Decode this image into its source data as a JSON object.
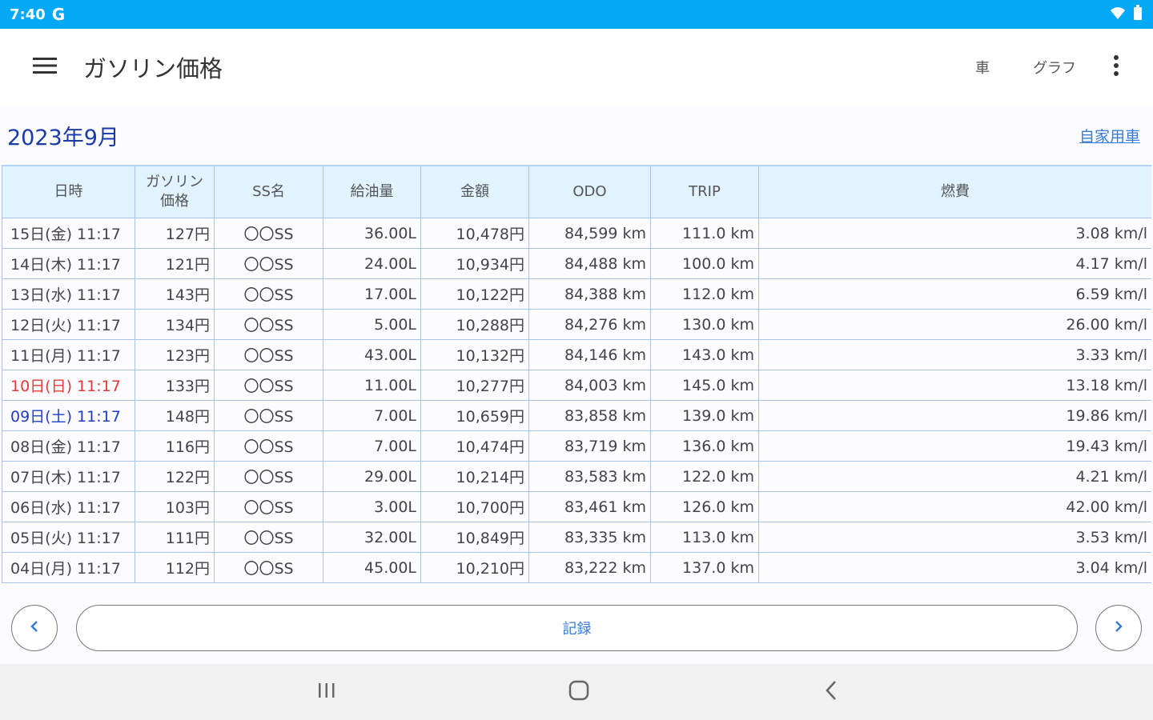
{
  "status_bar": {
    "time": "7:40",
    "carrier": "G"
  },
  "app_bar": {
    "title": "ガソリン価格",
    "actions": {
      "car": "車",
      "graph": "グラフ"
    }
  },
  "header": {
    "month": "2023年9月",
    "car_link": "自家用車"
  },
  "table": {
    "columns": [
      "日時",
      "ガソリン\n価格",
      "SS名",
      "給油量",
      "金額",
      "ODO",
      "TRIP",
      "燃費"
    ],
    "rows": [
      {
        "date": "15日(金) 11:17",
        "price": "127円",
        "ss": "〇〇SS",
        "volume": "36.00L",
        "amount": "10,478円",
        "odo": "84,599 km",
        "trip": "111.0 km",
        "mileage": "3.08 km/l",
        "day": "weekday"
      },
      {
        "date": "14日(木) 11:17",
        "price": "121円",
        "ss": "〇〇SS",
        "volume": "24.00L",
        "amount": "10,934円",
        "odo": "84,488 km",
        "trip": "100.0 km",
        "mileage": "4.17 km/l",
        "day": "weekday"
      },
      {
        "date": "13日(水) 11:17",
        "price": "143円",
        "ss": "〇〇SS",
        "volume": "17.00L",
        "amount": "10,122円",
        "odo": "84,388 km",
        "trip": "112.0 km",
        "mileage": "6.59 km/l",
        "day": "weekday"
      },
      {
        "date": "12日(火) 11:17",
        "price": "134円",
        "ss": "〇〇SS",
        "volume": "5.00L",
        "amount": "10,288円",
        "odo": "84,276 km",
        "trip": "130.0 km",
        "mileage": "26.00 km/l",
        "day": "weekday"
      },
      {
        "date": "11日(月) 11:17",
        "price": "123円",
        "ss": "〇〇SS",
        "volume": "43.00L",
        "amount": "10,132円",
        "odo": "84,146 km",
        "trip": "143.0 km",
        "mileage": "3.33 km/l",
        "day": "weekday"
      },
      {
        "date": "10日(日) 11:17",
        "price": "133円",
        "ss": "〇〇SS",
        "volume": "11.00L",
        "amount": "10,277円",
        "odo": "84,003 km",
        "trip": "145.0 km",
        "mileage": "13.18 km/l",
        "day": "sun"
      },
      {
        "date": "09日(土) 11:17",
        "price": "148円",
        "ss": "〇〇SS",
        "volume": "7.00L",
        "amount": "10,659円",
        "odo": "83,858 km",
        "trip": "139.0 km",
        "mileage": "19.86 km/l",
        "day": "sat"
      },
      {
        "date": "08日(金) 11:17",
        "price": "116円",
        "ss": "〇〇SS",
        "volume": "7.00L",
        "amount": "10,474円",
        "odo": "83,719 km",
        "trip": "136.0 km",
        "mileage": "19.43 km/l",
        "day": "weekday"
      },
      {
        "date": "07日(木) 11:17",
        "price": "122円",
        "ss": "〇〇SS",
        "volume": "29.00L",
        "amount": "10,214円",
        "odo": "83,583 km",
        "trip": "122.0 km",
        "mileage": "4.21 km/l",
        "day": "weekday"
      },
      {
        "date": "06日(水) 11:17",
        "price": "103円",
        "ss": "〇〇SS",
        "volume": "3.00L",
        "amount": "10,700円",
        "odo": "83,461 km",
        "trip": "126.0 km",
        "mileage": "42.00 km/l",
        "day": "weekday"
      },
      {
        "date": "05日(火) 11:17",
        "price": "111円",
        "ss": "〇〇SS",
        "volume": "32.00L",
        "amount": "10,849円",
        "odo": "83,335 km",
        "trip": "113.0 km",
        "mileage": "3.53 km/l",
        "day": "weekday"
      },
      {
        "date": "04日(月) 11:17",
        "price": "112円",
        "ss": "〇〇SS",
        "volume": "45.00L",
        "amount": "10,210円",
        "odo": "83,222 km",
        "trip": "137.0 km",
        "mileage": "3.04 km/l",
        "day": "weekday"
      }
    ]
  },
  "bottom": {
    "record_label": "記録"
  },
  "colors": {
    "status_bar": "#03a9f4",
    "month_title": "#1a3aa8",
    "link": "#3a7bd5",
    "header_bg": "#e0f3ff",
    "sunday": "#e53935",
    "saturday": "#1e3ec8"
  }
}
